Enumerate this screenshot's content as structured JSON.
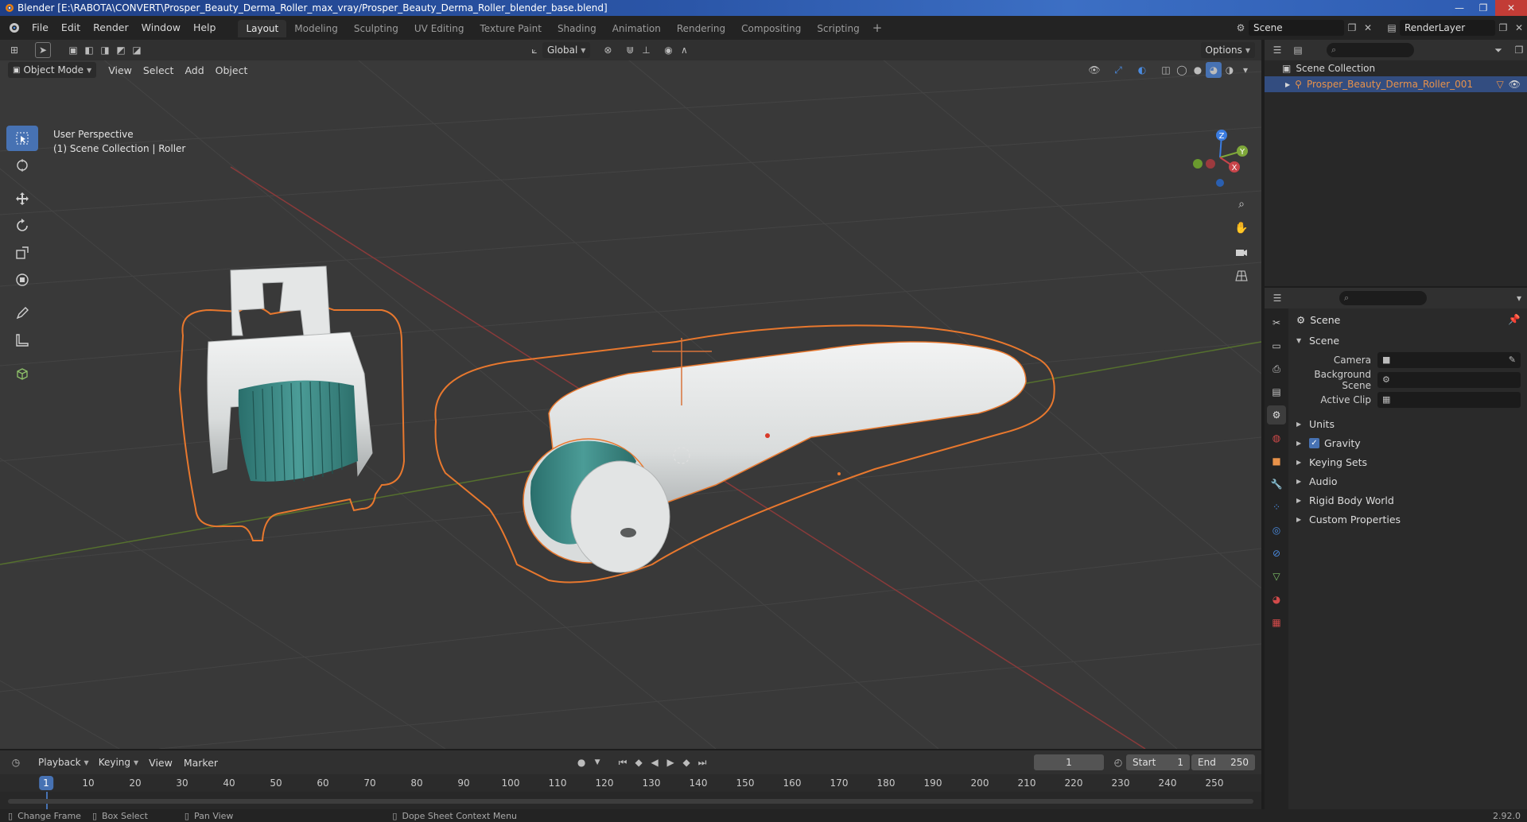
{
  "window": {
    "title": "Blender [E:\\RABOTA\\CONVERT\\Prosper_Beauty_Derma_Roller_max_vray/Prosper_Beauty_Derma_Roller_blender_base.blend]",
    "minimize": "—",
    "restore": "❐",
    "close": "✕"
  },
  "menu": [
    "File",
    "Edit",
    "Render",
    "Window",
    "Help"
  ],
  "workspaces": [
    "Layout",
    "Modeling",
    "Sculpting",
    "UV Editing",
    "Texture Paint",
    "Shading",
    "Animation",
    "Rendering",
    "Compositing",
    "Scripting"
  ],
  "active_workspace": "Layout",
  "add_workspace": "+",
  "scene_selector": "Scene",
  "view_layer": "RenderLayer",
  "viewport_header": {
    "transform_orientation": "Global",
    "options": "Options"
  },
  "viewport_menu": {
    "mode": "Object Mode",
    "items": [
      "View",
      "Select",
      "Add",
      "Object"
    ]
  },
  "viewport_overlay": {
    "line1": "User Perspective",
    "line2": "(1) Scene Collection | Roller"
  },
  "gizmo": {
    "z": "Z",
    "y": "Y",
    "x": "X"
  },
  "outliner": {
    "root": "Scene Collection",
    "object": "Prosper_Beauty_Derma_Roller_001"
  },
  "properties": {
    "context_title": "Scene",
    "panel_scene": "Scene",
    "rows": [
      {
        "label": "Camera"
      },
      {
        "label": "Background Scene"
      },
      {
        "label": "Active Clip"
      }
    ],
    "collapsed_panels": [
      "Units",
      "Gravity",
      "Keying Sets",
      "Audio",
      "Rigid Body World",
      "Custom Properties"
    ],
    "gravity_checked": true
  },
  "timeline": {
    "menu": [
      "Playback",
      "Keying",
      "View",
      "Marker"
    ],
    "current_frame": "1",
    "start_label": "Start",
    "start": "1",
    "end_label": "End",
    "end": "250",
    "ticks": [
      "10",
      "20",
      "30",
      "40",
      "50",
      "60",
      "70",
      "80",
      "90",
      "100",
      "110",
      "120",
      "130",
      "140",
      "150",
      "160",
      "170",
      "180",
      "190",
      "200",
      "210",
      "220",
      "230",
      "240",
      "250"
    ],
    "playhead": "1"
  },
  "statusbar": {
    "items": [
      "Change Frame",
      "Box Select",
      "Pan View",
      "Dope Sheet Context Menu"
    ],
    "version": "2.92.0"
  },
  "colors": {
    "accent": "#4772b3",
    "selection_outline": "#e8782e",
    "x_axis": "#c8444a",
    "y_axis": "#7fa83a",
    "z_axis": "#3b7ce0"
  }
}
